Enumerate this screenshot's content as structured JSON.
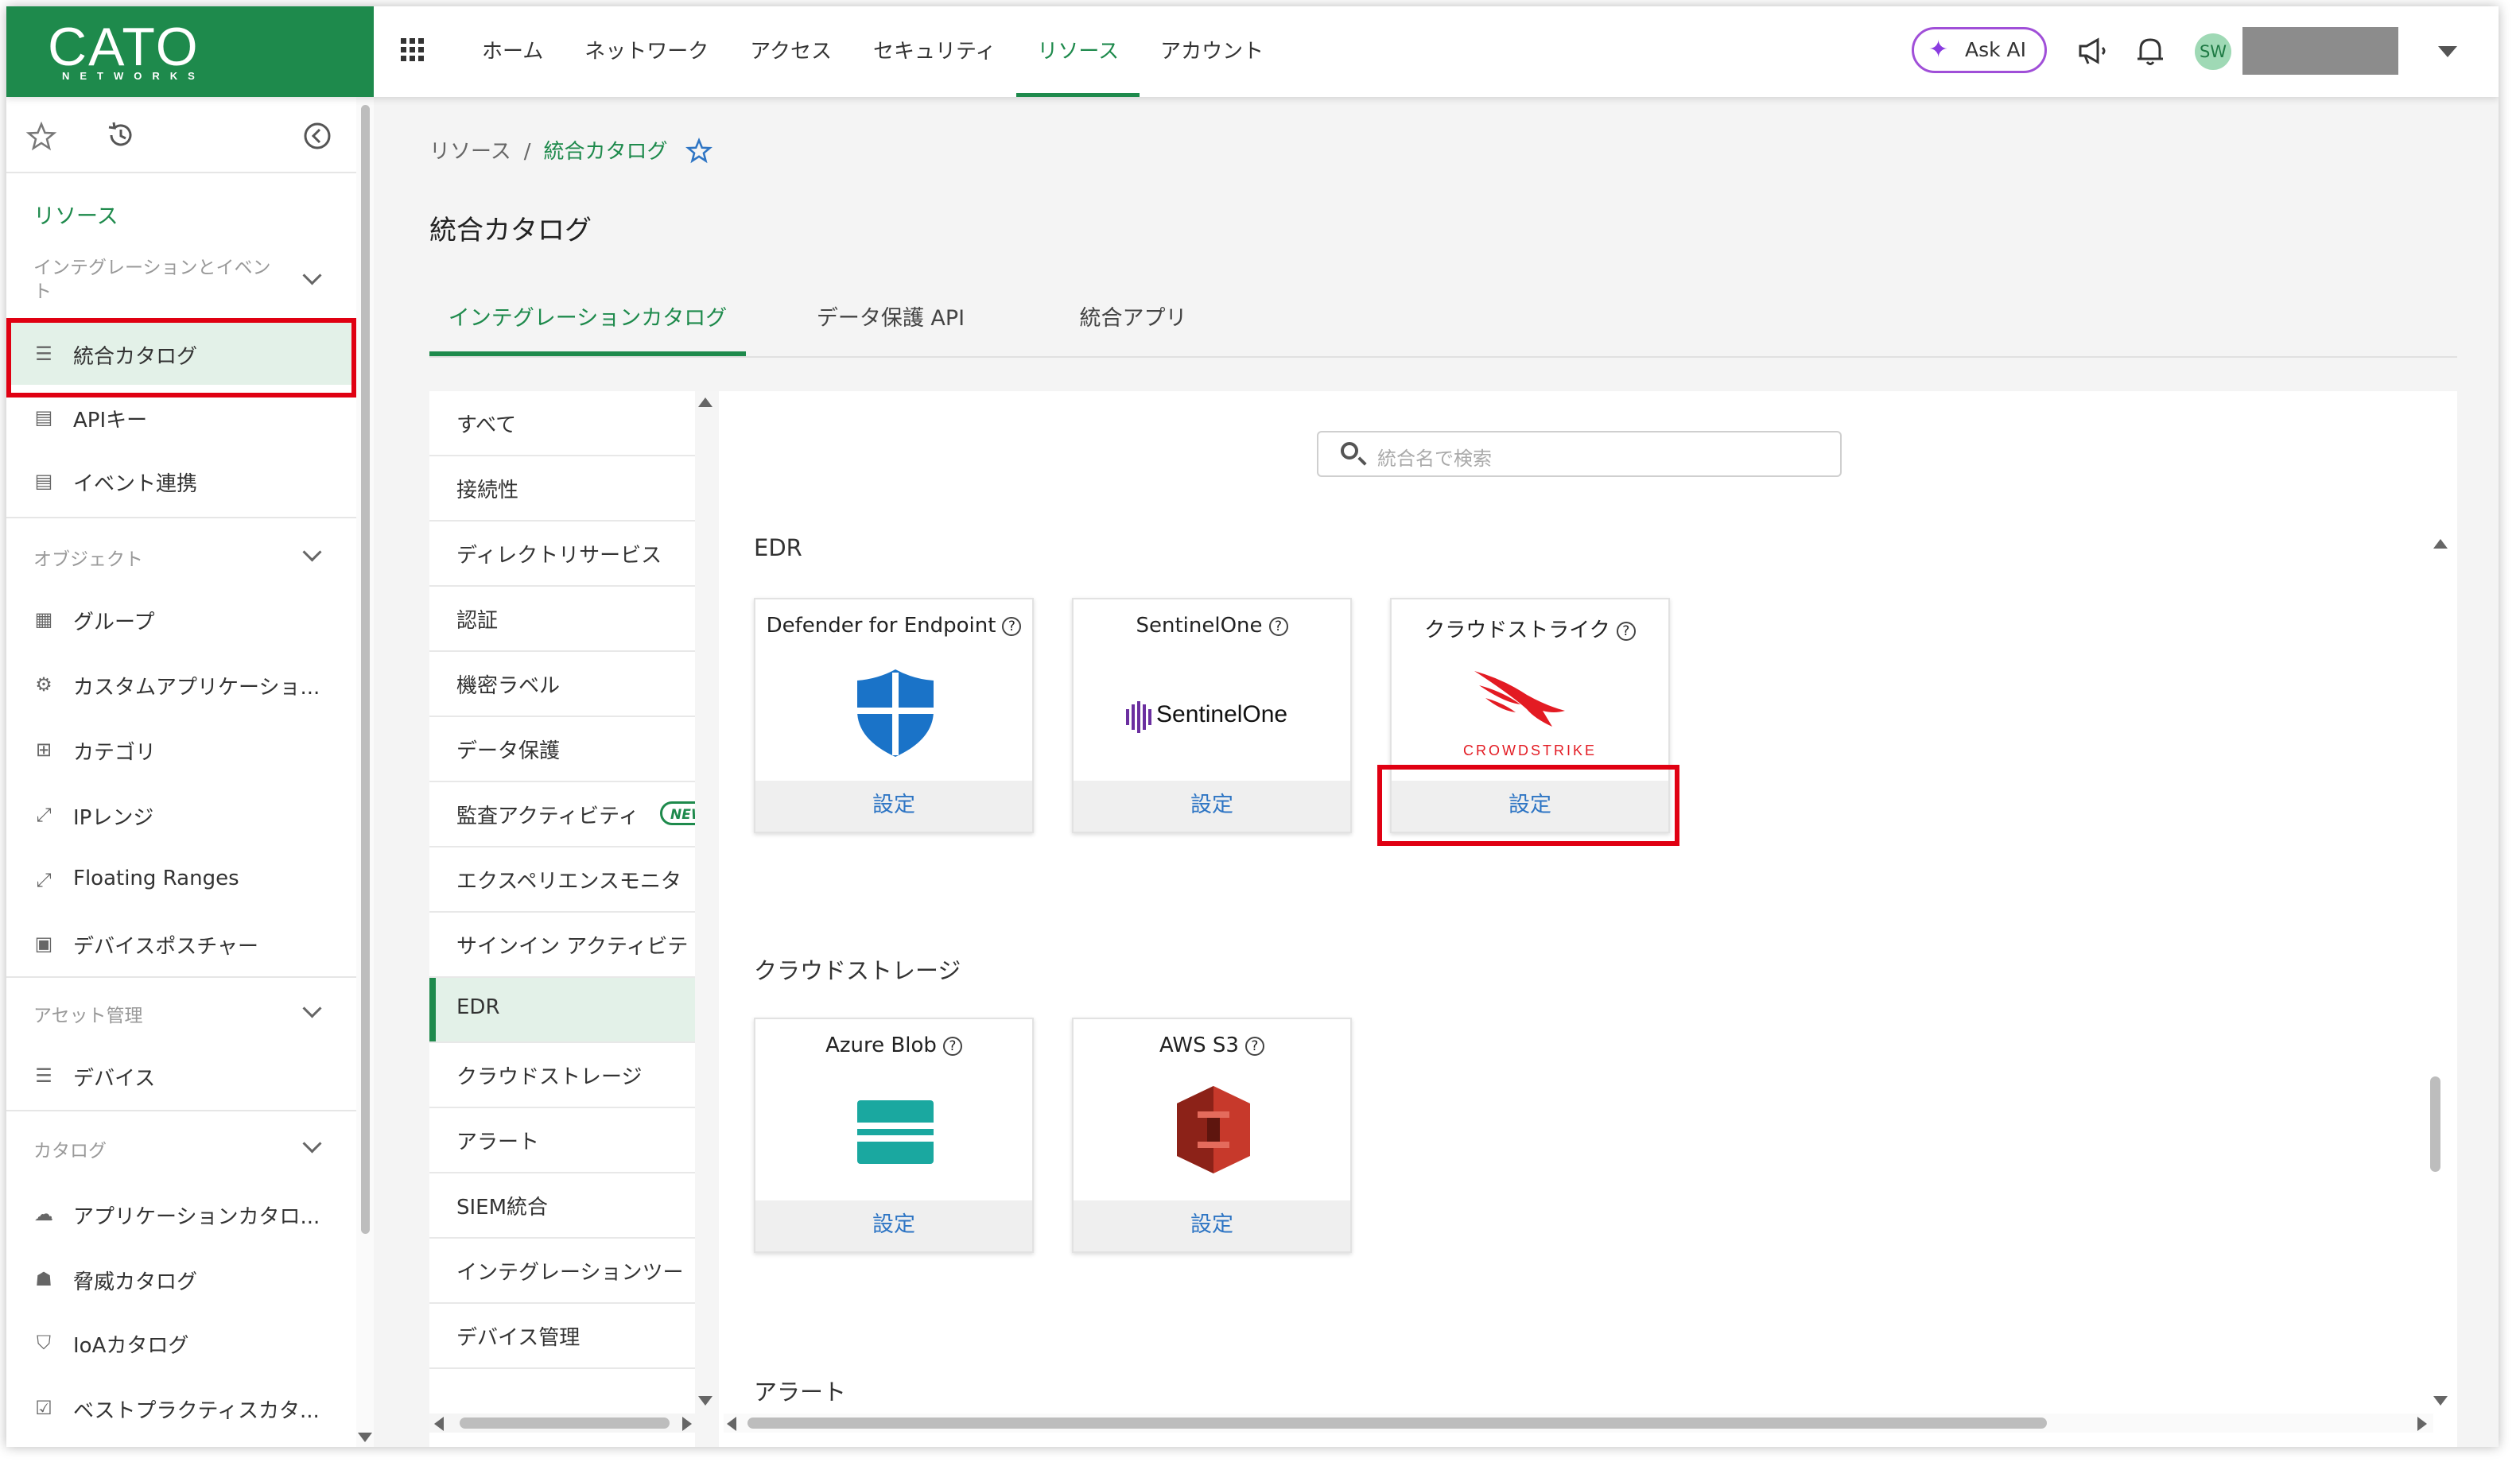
{
  "logo": {
    "brand": "CATO",
    "sub": "NETWORKS"
  },
  "nav": {
    "items": [
      "ホーム",
      "ネットワーク",
      "アクセス",
      "セキュリティ",
      "リソース",
      "アカウント"
    ],
    "active": "リソース"
  },
  "header": {
    "ask_ai": "Ask AI",
    "avatar_initials": "SW"
  },
  "sidebar": {
    "section_title": "リソース",
    "group_integrations": "インテグレーションとイベント",
    "items_integrations": [
      "統合カタログ",
      "APIキー",
      "イベント連携"
    ],
    "group_objects": "オブジェクト",
    "items_objects": [
      "グループ",
      "カスタムアプリケーショ...",
      "カテゴリ",
      "IPレンジ",
      "Floating Ranges",
      "デバイスポスチャー"
    ],
    "group_assets": "アセット管理",
    "items_assets": [
      "デバイス"
    ],
    "group_catalog": "カタログ",
    "items_catalog": [
      "アプリケーションカタロ...",
      "脅威カタログ",
      "IoAカタログ",
      "ベストプラクティスカタ..."
    ]
  },
  "breadcrumb": {
    "parent": "リソース",
    "separator": "/",
    "current": "統合カタログ"
  },
  "page_title": "統合カタログ",
  "tabs": [
    "インテグレーションカタログ",
    "データ保護 API",
    "統合アプリ"
  ],
  "categories": [
    "すべて",
    "接続性",
    "ディレクトリサービス",
    "認証",
    "機密ラベル",
    "データ保護",
    "監査アクティビティ",
    "エクスペリエンスモニタ",
    "サインイン アクティビテ",
    "EDR",
    "クラウドストレージ",
    "アラート",
    "SIEM統合",
    "インテグレーションツー",
    "デバイス管理"
  ],
  "active_category": "EDR",
  "new_badge": "NEW",
  "search": {
    "placeholder": "統合名で検索"
  },
  "sections": {
    "edr": {
      "title": "EDR",
      "cards": [
        {
          "name": "Defender for Endpoint",
          "action": "設定"
        },
        {
          "name": "SentinelOne",
          "logo_text": "SentinelOne",
          "action": "設定"
        },
        {
          "name": "クラウドストライク",
          "logo_text": "CROWDSTRIKE",
          "action": "設定"
        }
      ]
    },
    "storage": {
      "title": "クラウドストレージ",
      "cards": [
        {
          "name": "Azure Blob",
          "action": "設定"
        },
        {
          "name": "AWS S3",
          "action": "設定"
        }
      ]
    },
    "alerts": {
      "title": "アラート"
    }
  },
  "colors": {
    "brand_green": "#1e8a4c",
    "highlight_red": "#e00012",
    "link_blue": "#2e75c4",
    "ask_ai_purple": "#a04fd8"
  }
}
